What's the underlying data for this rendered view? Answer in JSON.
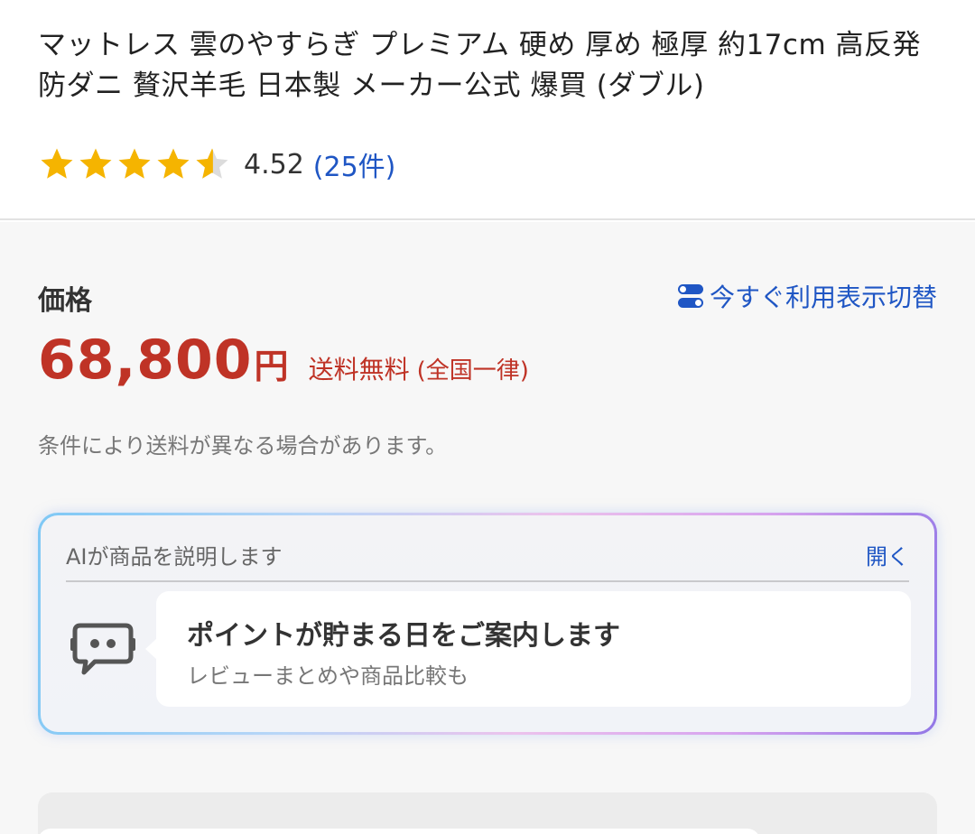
{
  "product": {
    "title": "マットレス 雲のやすらぎ プレミアム 硬め 厚め 極厚 約17cm 高反発 防ダニ 贅沢羊毛 日本製 メーカー公式 爆買 (ダブル)",
    "rating_value": "4.52",
    "rating_stars": 4.52,
    "review_count_label": "(25件)",
    "star_color": "#f5b400"
  },
  "price": {
    "label": "価格",
    "toggle_label": "今すぐ利用表示切替",
    "amount": "68,800",
    "unit": "円",
    "shipping": "送料無料",
    "shipping_note": "(全国一律)",
    "condition_note": "条件により送料が異なる場合があります。",
    "accent_color": "#bf3326"
  },
  "ai_card": {
    "header": "AIが商品を説明します",
    "open_label": "開く",
    "icon": "chat-bot-icon",
    "title": "ポイントが貯まる日をご案内します",
    "subtitle": "レビューまとめや商品比較も"
  },
  "colors": {
    "link": "#1f56c4",
    "background": "#f7f7f7"
  }
}
